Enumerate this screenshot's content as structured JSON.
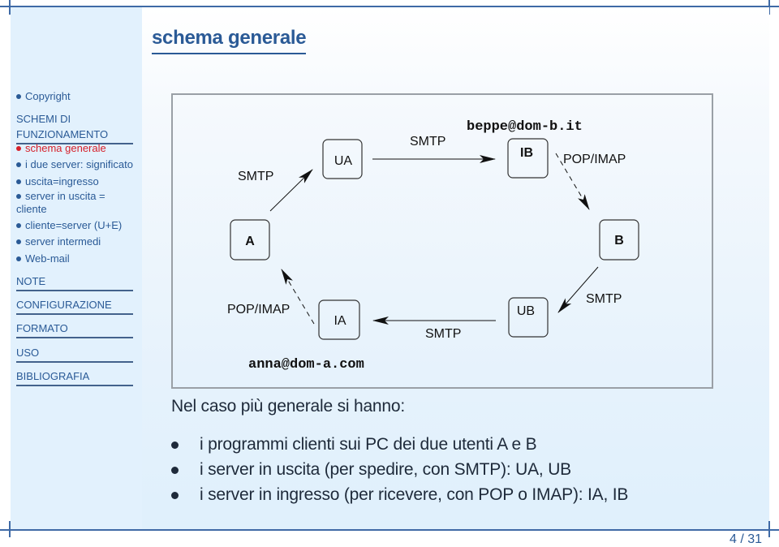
{
  "slide": {
    "title": "schema generale",
    "page_number": "4 / 31"
  },
  "sidebar": {
    "top_items": [
      {
        "label": "Copyright",
        "active": false
      }
    ],
    "current_section": "SCHEMI DI FUNZIONAMENTO",
    "current_section_lines": [
      "SCHEMI DI",
      "FUNZIONAMENTO"
    ],
    "section_items": [
      {
        "label": "schema generale",
        "active": true
      },
      {
        "label": "i due server: significato",
        "active": false
      },
      {
        "label": "uscita=ingresso",
        "active": false
      },
      {
        "label": "server in uscita =",
        "active": false
      },
      {
        "label": "cliente",
        "active": false
      },
      {
        "label": "cliente=server (U+E)",
        "active": false
      },
      {
        "label": "server intermedi",
        "active": false
      },
      {
        "label": "Web-mail",
        "active": false
      }
    ],
    "sections": [
      "NOTE",
      "CONFIGURAZIONE",
      "FORMATO",
      "USO",
      "BIBLIOGRAFIA"
    ],
    "colors": {
      "active": "#d6202a",
      "normal": "#2a5a96"
    }
  },
  "diagram": {
    "nodes": {
      "A": "A",
      "UA": "UA",
      "IB": "IB",
      "B": "B",
      "IA": "IA",
      "UB": "UB"
    },
    "labels": {
      "a_to_ua": "SMTP",
      "ua_to_ib": "SMTP",
      "ib_to_b": "POP/IMAP",
      "b_to_ub": "SMTP",
      "ub_to_ia": "SMTP",
      "ia_to_a": "POP/IMAP",
      "address_b": "beppe@dom-b.it",
      "address_a": "anna@dom-a.com"
    }
  },
  "content": {
    "intro": "Nel caso più generale si hanno:",
    "bullets": [
      "i programmi clienti sui PC dei due utenti A e B",
      "i server in uscita (per spedire, con SMTP): UA, UB",
      "i server in ingresso (per ricevere, con POP o IMAP): IA, IB"
    ]
  }
}
